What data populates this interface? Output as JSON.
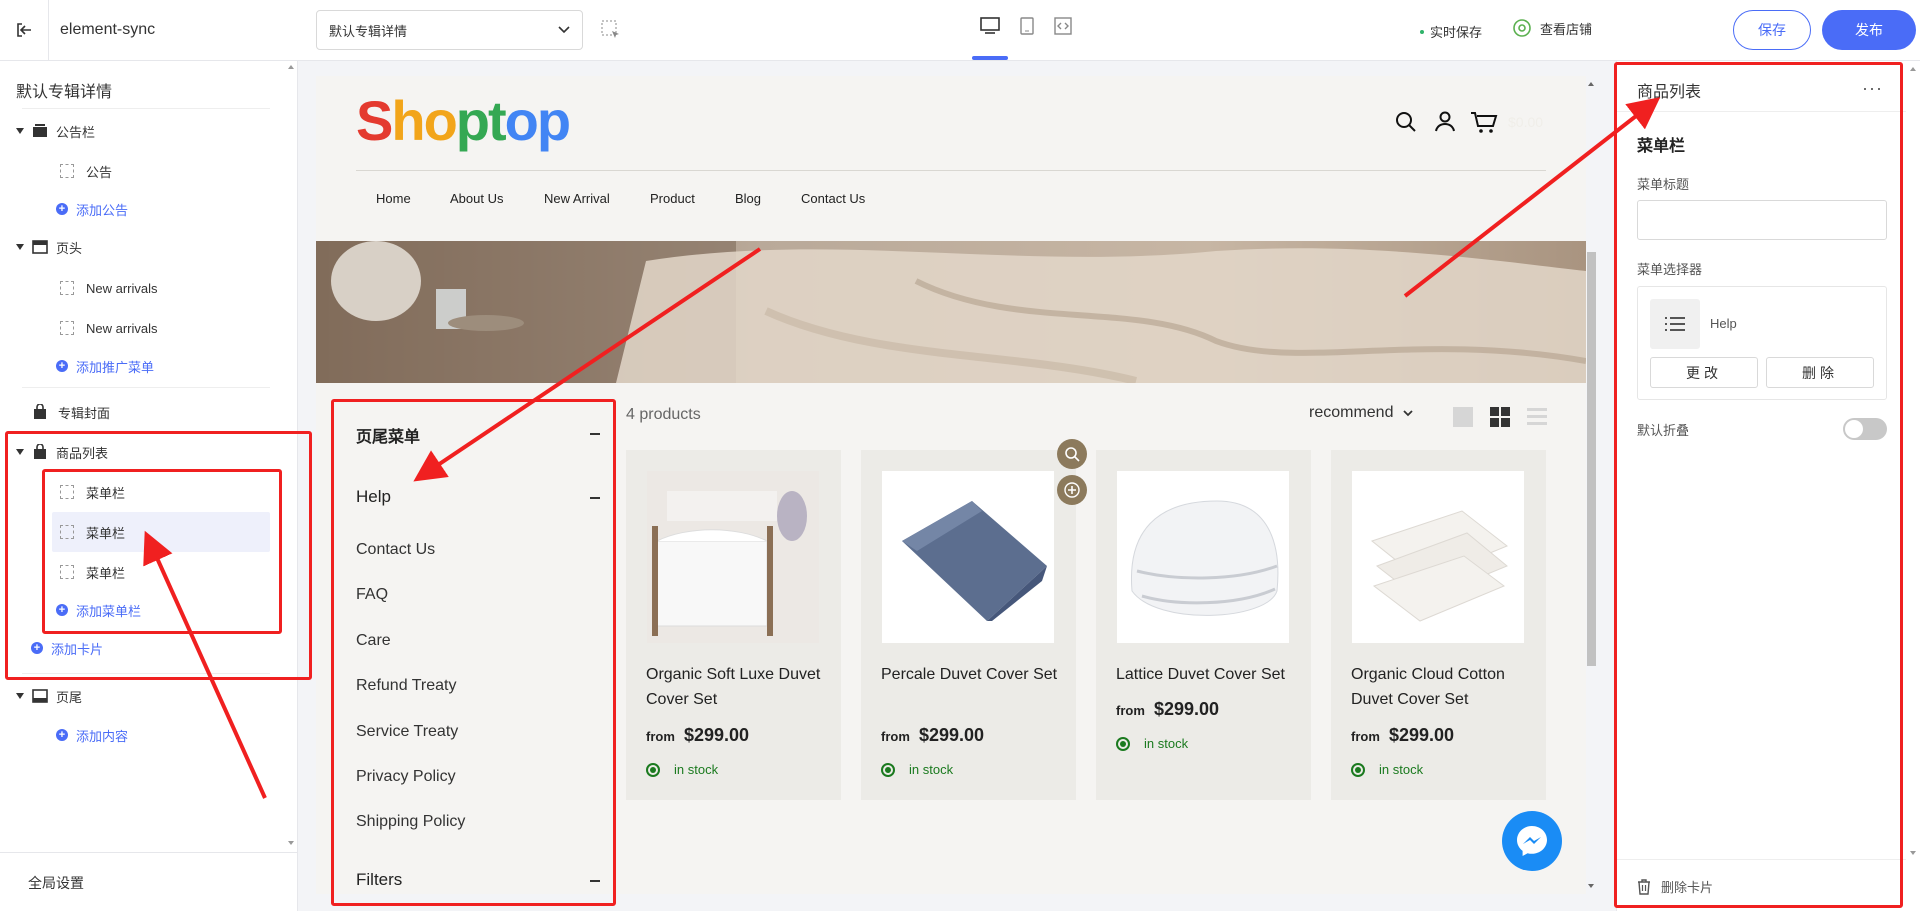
{
  "topbar": {
    "app_title": "element-sync",
    "page_select": "默认专辑详情",
    "autosave": "实时保存",
    "view_store": "查看店铺",
    "save": "保存",
    "publish": "发布"
  },
  "sidebar": {
    "title": "默认专辑详情",
    "items": [
      {
        "label": "公告栏"
      },
      {
        "label": "公告"
      },
      {
        "label": "添加公告"
      },
      {
        "label": "页头"
      },
      {
        "label": "New arrivals"
      },
      {
        "label": "New arrivals"
      },
      {
        "label": "添加推广菜单"
      },
      {
        "label": "专辑封面"
      },
      {
        "label": "商品列表"
      },
      {
        "label": "菜单栏"
      },
      {
        "label": "菜单栏"
      },
      {
        "label": "菜单栏"
      },
      {
        "label": "添加菜单栏"
      },
      {
        "label": "添加卡片"
      },
      {
        "label": "页尾"
      },
      {
        "label": "添加内容"
      }
    ],
    "global_settings": "全局设置"
  },
  "store": {
    "logo": "Shoptop",
    "logo_colors": [
      "#e43a2f",
      "#f2a51a",
      "#f2a51a",
      "#34a853",
      "#34a853",
      "#4285f4",
      "#4285f4"
    ],
    "cart_amount": "$0.00",
    "nav": [
      "Home",
      "About Us",
      "New Arrival",
      "Product",
      "Blog",
      "Contact Us"
    ],
    "footer_menu": {
      "title": "页尾菜单",
      "help": "Help",
      "links": [
        "Contact Us",
        "FAQ",
        "Care",
        "Refund Treaty",
        "Service Treaty",
        "Privacy Policy",
        "Shipping Policy"
      ],
      "filters": "Filters"
    },
    "product_count": "4 products",
    "sort": "recommend",
    "products": [
      {
        "name": "Organic Soft Luxe Duvet Cover Set",
        "from": "from",
        "price": "$299.00",
        "stock": "in stock"
      },
      {
        "name": "Percale Duvet Cover Set",
        "from": "from",
        "price": "$299.00",
        "stock": "in stock"
      },
      {
        "name": "Lattice Duvet Cover Set",
        "from": "from",
        "price": "$299.00",
        "stock": "in stock"
      },
      {
        "name": "Organic Cloud Cotton Duvet Cover Set",
        "from": "from",
        "price": "$299.00",
        "stock": "in stock"
      }
    ]
  },
  "right_panel": {
    "title": "商品列表",
    "more": "···",
    "section": "菜单栏",
    "menu_title_label": "菜单标题",
    "menu_title_value": "",
    "menu_selector_label": "菜单选择器",
    "menu_name": "Help",
    "edit": "更改",
    "delete": "删除",
    "collapse_label": "默认折叠",
    "collapse_on": false,
    "delete_card": "删除卡片"
  },
  "colors": {
    "accent": "#4a6cf7",
    "annotation": "#f02020",
    "stock": "#1b7a1f"
  }
}
